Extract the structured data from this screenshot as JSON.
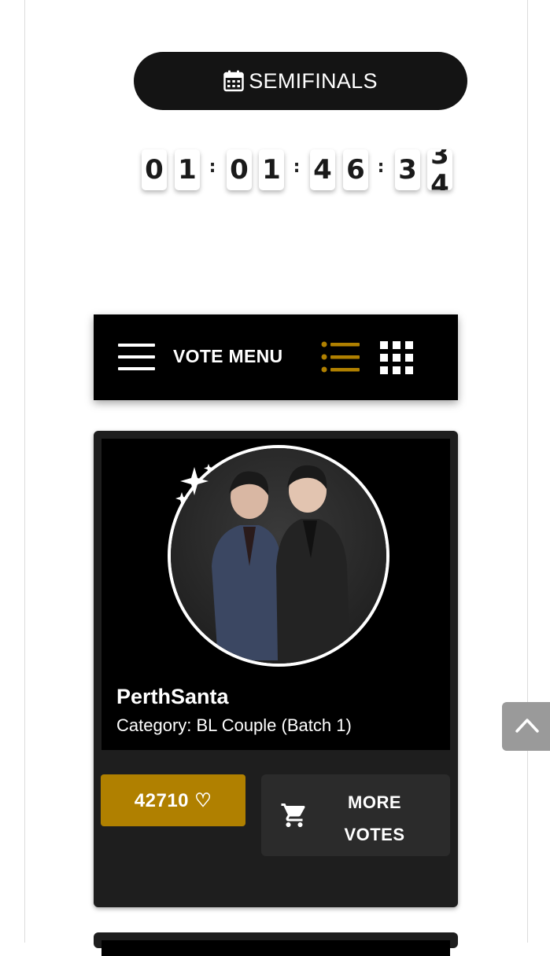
{
  "stage": {
    "label": "SEMIFINALS",
    "icon": "calendar-icon"
  },
  "countdown": {
    "digits": [
      "0",
      "1",
      "0",
      "1",
      "4",
      "6",
      "3",
      "3"
    ],
    "separator": ":",
    "rolling_next_digit": "4"
  },
  "vote_menu": {
    "label": "VOTE MENU",
    "icons": [
      "hamburger-icon",
      "list-view-icon",
      "grid-view-icon"
    ],
    "active_view_color": "#b08000"
  },
  "nominee": {
    "name": "PerthSanta",
    "category": "Category: BL Couple (Batch 1)",
    "votes_label": "42710 ♡",
    "more_votes_line1": "MORE",
    "more_votes_line2": "VOTES",
    "icons": [
      "photo-avatar",
      "sparkle-icon",
      "cart-icon"
    ]
  },
  "scroll_top": {
    "icon": "chevron-up-icon"
  },
  "colors": {
    "accent_gold": "#b08000",
    "dark": "#141414",
    "card_bg": "#1e1e1e"
  }
}
